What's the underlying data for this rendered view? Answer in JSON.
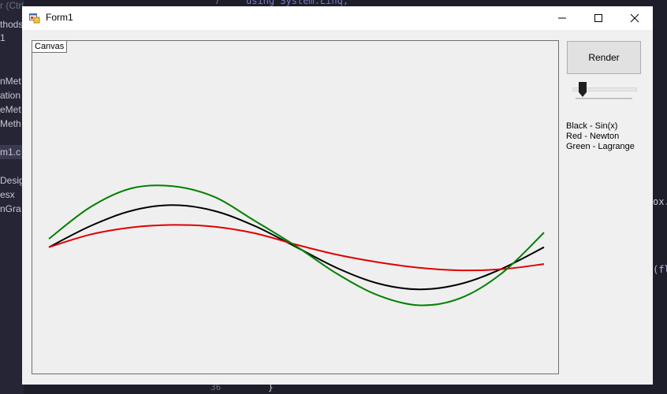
{
  "background_ide": {
    "left_items": [
      "r (Ctrl+",
      "thods",
      "1",
      "nMet",
      "ation",
      "eMet",
      "Meth",
      "m1.c",
      "Design",
      "esx",
      "nGra"
    ],
    "right_items": [
      "ox.",
      "(fl"
    ],
    "top_code": "using System.Linq;",
    "top_line_number": "7",
    "bottom_line_number": "36",
    "bottom_code": "}"
  },
  "window": {
    "title": "Form1",
    "minimize_label": "—",
    "close_label": "✕"
  },
  "canvas": {
    "label": "Canvas"
  },
  "controls": {
    "render_label": "Render",
    "slider_value_fraction": 0.1
  },
  "legend": [
    "Black - Sin(x)",
    "Red - Newton",
    "Green - Lagrange"
  ],
  "colors": {
    "sin": "#000000",
    "newton": "#e00000",
    "lagrange": "#008000"
  },
  "chart_data": {
    "type": "line",
    "series": [
      {
        "name": "Black - Sin(x)",
        "color": "#000000",
        "x": [
          0,
          0.5236,
          1.0472,
          1.5708,
          2.0944,
          2.618,
          3.1416,
          3.6652,
          4.1888,
          4.7124,
          5.236,
          5.7596,
          6.2832
        ],
        "values": [
          0,
          0.5,
          0.866,
          1,
          0.866,
          0.5,
          0,
          -0.5,
          -0.866,
          -1,
          -0.866,
          -0.5,
          0
        ]
      },
      {
        "name": "Red - Newton",
        "color": "#e00000",
        "x": [
          0,
          0.5236,
          1.0472,
          1.5708,
          2.0944,
          2.618,
          3.1416,
          3.6652,
          4.1888,
          4.7124,
          5.236,
          5.7596,
          6.2832
        ],
        "values": [
          0,
          0.3,
          0.47,
          0.53,
          0.49,
          0.33,
          0.06,
          -0.18,
          -0.36,
          -0.49,
          -0.55,
          -0.52,
          -0.4
        ]
      },
      {
        "name": "Green - Lagrange",
        "color": "#008000",
        "x": [
          0,
          0.5236,
          1.0472,
          1.5708,
          2.0944,
          2.618,
          3.1416,
          3.6652,
          4.1888,
          4.7124,
          5.236,
          5.7596,
          6.2832
        ],
        "values": [
          0.2,
          0.95,
          1.4,
          1.45,
          1.2,
          0.62,
          0.02,
          -0.64,
          -1.15,
          -1.38,
          -1.2,
          -0.6,
          0.35
        ]
      }
    ],
    "xlim": [
      0,
      6.2832
    ],
    "ylim": [
      -3.0,
      4.9
    ]
  }
}
